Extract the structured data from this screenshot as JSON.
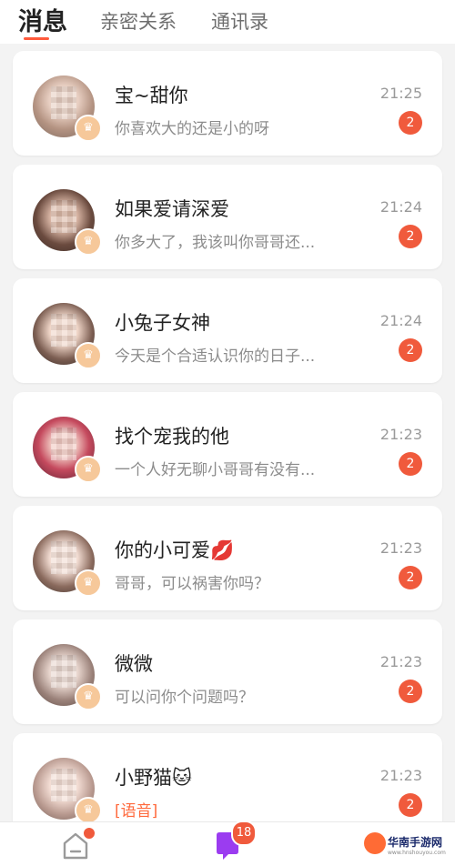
{
  "tabs": [
    {
      "label": "消息",
      "active": true
    },
    {
      "label": "亲密关系",
      "active": false
    },
    {
      "label": "通讯录",
      "active": false
    }
  ],
  "conversations": [
    {
      "name": "宝~甜你",
      "preview": "你喜欢大的还是小的呀",
      "time": "21:25",
      "unread": "2"
    },
    {
      "name": "如果爱请深爱",
      "preview": "你多大了，我该叫你哥哥还...",
      "time": "21:24",
      "unread": "2"
    },
    {
      "name": "小兔子女神",
      "preview": "今天是个合适认识你的日子...",
      "time": "21:24",
      "unread": "2"
    },
    {
      "name": "找个宠我的他",
      "preview": "一个人好无聊小哥哥有没有...",
      "time": "21:23",
      "unread": "2"
    },
    {
      "name": "你的小可爱💋",
      "preview": "哥哥，可以祸害你吗？",
      "time": "21:23",
      "unread": "2"
    },
    {
      "name": "微微",
      "preview": "可以问你个问题吗？",
      "time": "21:23",
      "unread": "2"
    },
    {
      "name": "小野猫🐱",
      "preview": "[语音]",
      "time": "21:23",
      "unread": "2"
    }
  ],
  "bottom_nav": {
    "messages_badge": "18"
  },
  "watermark": {
    "text": "华南手游网",
    "sub": "www.hnshouyou.com"
  },
  "colors": {
    "accent": "#f05a3c",
    "voice": "#ff6a3d"
  }
}
